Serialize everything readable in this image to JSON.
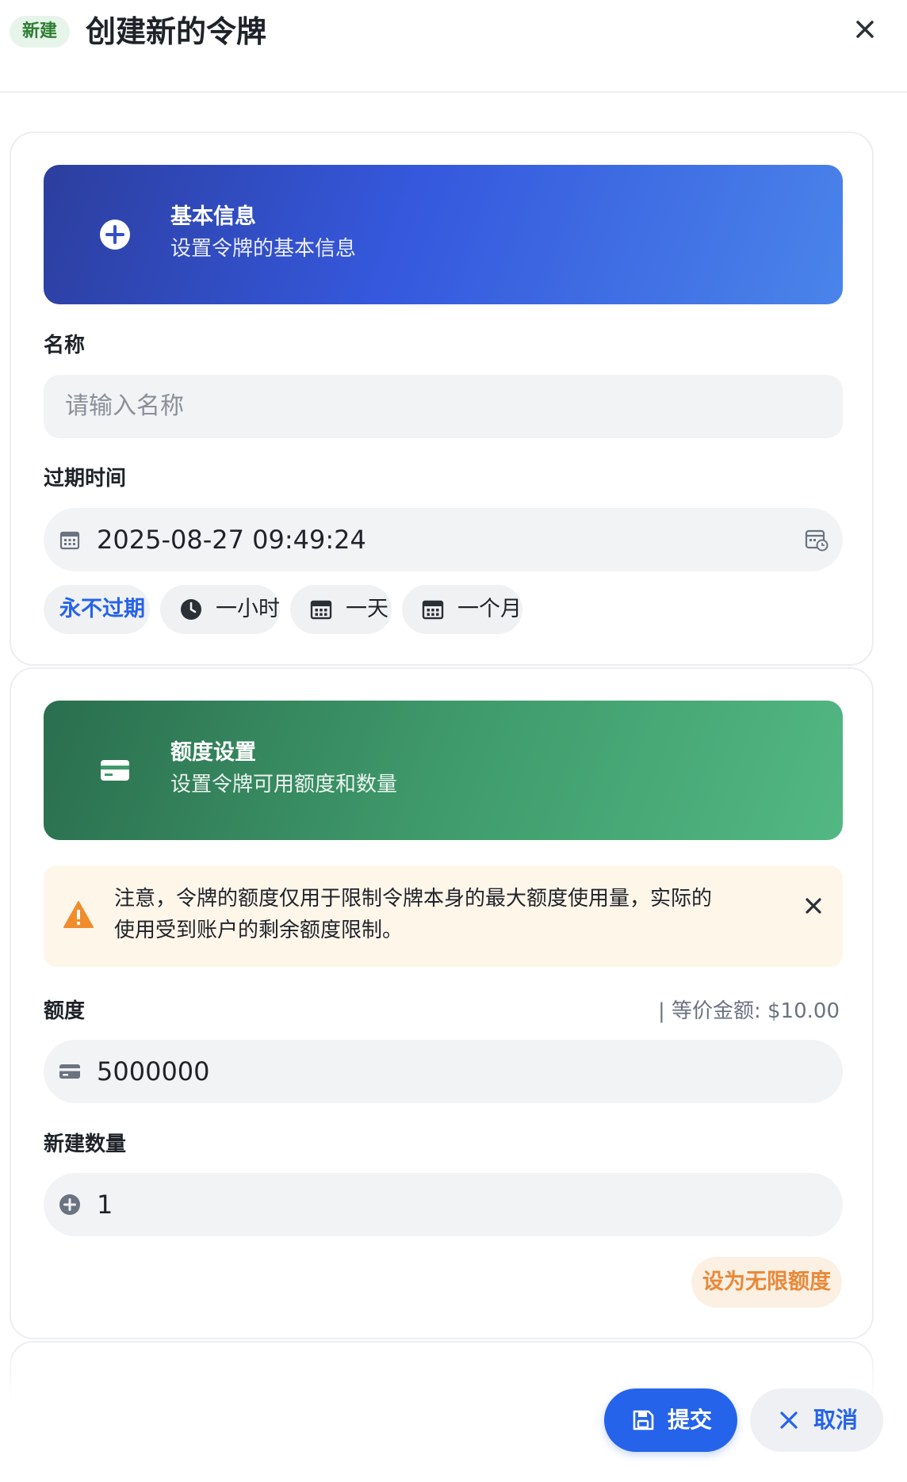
{
  "header": {
    "badge": "新建",
    "title": "创建新的令牌"
  },
  "basic_info": {
    "title": "基本信息",
    "subtitle": "设置令牌的基本信息",
    "name_label": "名称",
    "name_placeholder": "请输入名称",
    "expire_label": "过期时间",
    "expire_value": "2025-08-27 09:49:24",
    "quick_options": [
      {
        "label": "永不过期",
        "icon": "none"
      },
      {
        "label": "一小时",
        "icon": "clock-icon"
      },
      {
        "label": "一天",
        "icon": "calendar-icon"
      },
      {
        "label": "一个月",
        "icon": "calendar-icon"
      }
    ]
  },
  "quota": {
    "title": "额度设置",
    "subtitle": "设置令牌可用额度和数量",
    "notice_line1": "注意，令牌的额度仅用于限制令牌本身的最大额度使用量，实际的",
    "notice_line2": "使用受到账户的剩余额度限制。",
    "quota_label": "额度",
    "equivalent": "| 等价金额: $10.00",
    "quota_value": "5000000",
    "count_label": "新建数量",
    "count_value": "1",
    "unlimited_button": "设为无限额度"
  },
  "footer": {
    "submit": "提交",
    "cancel": "取消"
  },
  "colors": {
    "primary": "#2563eb",
    "badge_bg": "#e6f4ea",
    "badge_text": "#2e7d32",
    "warning": "#f08c2b",
    "unlimited_text": "#e8893a"
  }
}
